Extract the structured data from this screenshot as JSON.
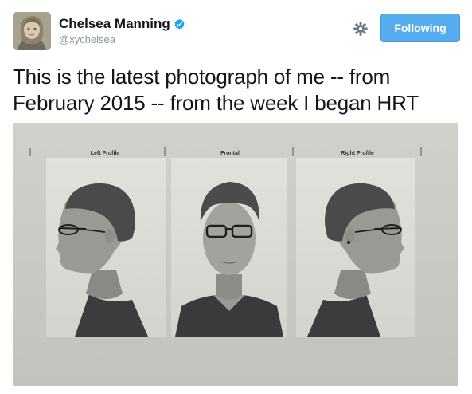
{
  "user": {
    "full_name": "Chelsea Manning",
    "screen_name": "@xychelsea",
    "verified_icon": "verified-badge-icon",
    "avatar_icon": "avatar-portrait"
  },
  "actions": {
    "settings_icon": "gear-icon",
    "follow_label": "Following",
    "follow_color": "#55acee"
  },
  "tweet": {
    "line1": "This is the latest photograph of me -- from",
    "line2": "February 2015 -- from the week I began HRT"
  },
  "photo": {
    "panel_labels": [
      "Left Profile",
      "Frontal",
      "Right Profile"
    ]
  }
}
